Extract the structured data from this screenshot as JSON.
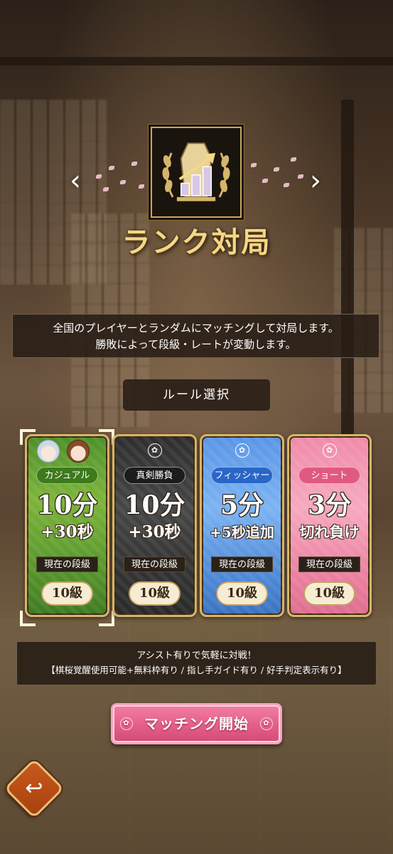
{
  "header": {
    "mode_title": "ランク対局",
    "prev_glyph": "‹",
    "next_glyph": "›",
    "emblem_icon": "rank-emblem-icon"
  },
  "description": {
    "line1": "全国のプレイヤーとランダムにマッチングして対局します。",
    "line2": "勝敗によって段級・レートが変動します。"
  },
  "rule_select_label": "ルール選択",
  "cards": [
    {
      "name": "カジュアル",
      "main": "10分",
      "sub": "+30秒",
      "rank_label": "現在の段級",
      "rank": "10級",
      "color": "#5c9a2e",
      "selected": true
    },
    {
      "name": "真剣勝負",
      "main": "10分",
      "sub": "+30秒",
      "rank_label": "現在の段級",
      "rank": "10級",
      "color": "#333333",
      "selected": false
    },
    {
      "name": "フィッシャー",
      "main": "5分",
      "sub": "+5秒追加",
      "rank_label": "現在の段級",
      "rank": "10級",
      "color": "#4d88d6",
      "selected": false
    },
    {
      "name": "ショート",
      "main": "3分",
      "sub": "切れ負け",
      "rank_label": "現在の段級",
      "rank": "10級",
      "color": "#ea7e9e",
      "selected": false
    }
  ],
  "crest_glyph": "✿",
  "assist": {
    "line1": "アシスト有りで気軽に対戦！",
    "line2": "【棋桜覚醒使用可能+無料枠有り / 指し手ガイド有り / 好手判定表示有り】"
  },
  "match_button_label": "マッチング開始",
  "back_glyph": "↩",
  "colors": {
    "gold": "#d8b46a",
    "title_gold": "#f3d889",
    "match_pink": "#e45f88",
    "back_orange": "#c85a1e"
  }
}
